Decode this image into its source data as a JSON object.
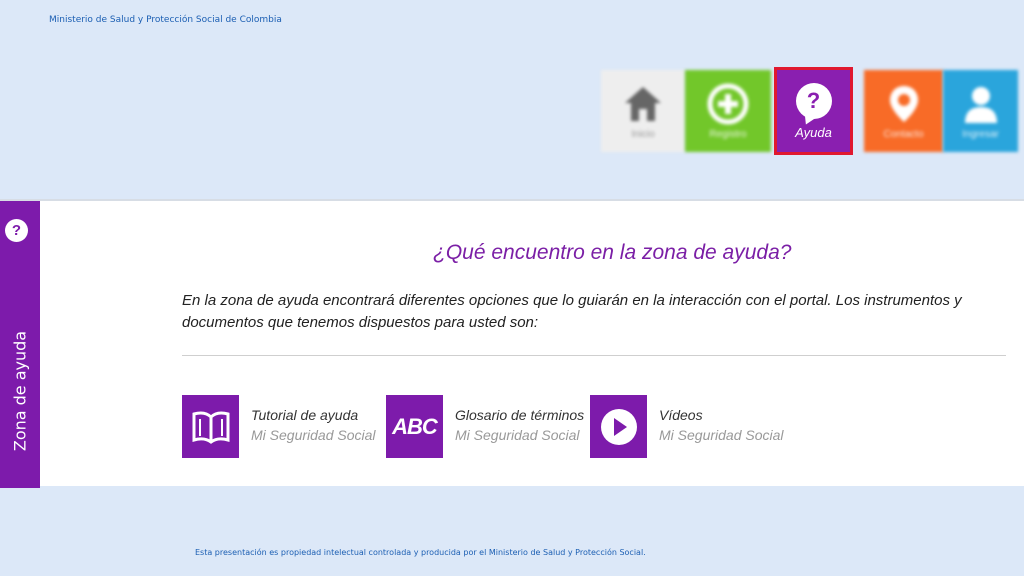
{
  "header": {
    "ministry": "Ministerio de Salud y Protección Social de Colombia"
  },
  "nav": {
    "items": [
      {
        "label": "Inicio",
        "icon": "home-icon",
        "color": "#eeeeee"
      },
      {
        "label": "Registro",
        "icon": "plus-icon",
        "color": "#72c72a"
      },
      {
        "label": "Ayuda",
        "icon": "help-icon",
        "color": "#8a1fb0",
        "active": true
      },
      {
        "label": "Contacto",
        "icon": "location-pin-icon",
        "color": "#f86b27"
      },
      {
        "label": "Ingresar",
        "icon": "user-icon",
        "color": "#2aa5dc"
      }
    ]
  },
  "sidebar": {
    "label": "Zona de ayuda",
    "color": "#7d1bab"
  },
  "main": {
    "heading": "¿Qué encuentro en la zona de ayuda?",
    "intro": "En la zona de ayuda encontrará diferentes opciones que lo guiarán en la interacción con el portal. Los instrumentos y documentos que tenemos dispuestos para usted son:",
    "options": [
      {
        "title": "Tutorial de ayuda",
        "subtitle": "Mi Seguridad Social",
        "icon": "book-icon"
      },
      {
        "title": "Glosario de términos",
        "subtitle": "Mi Seguridad Social",
        "icon": "abc-icon",
        "icon_text": "ABC"
      },
      {
        "title": "Vídeos",
        "subtitle": "Mi Seguridad Social",
        "icon": "play-icon"
      }
    ]
  },
  "footer": {
    "text": "Esta presentación es propiedad intelectual controlada y producida por el Ministerio de Salud y Protección Social."
  }
}
